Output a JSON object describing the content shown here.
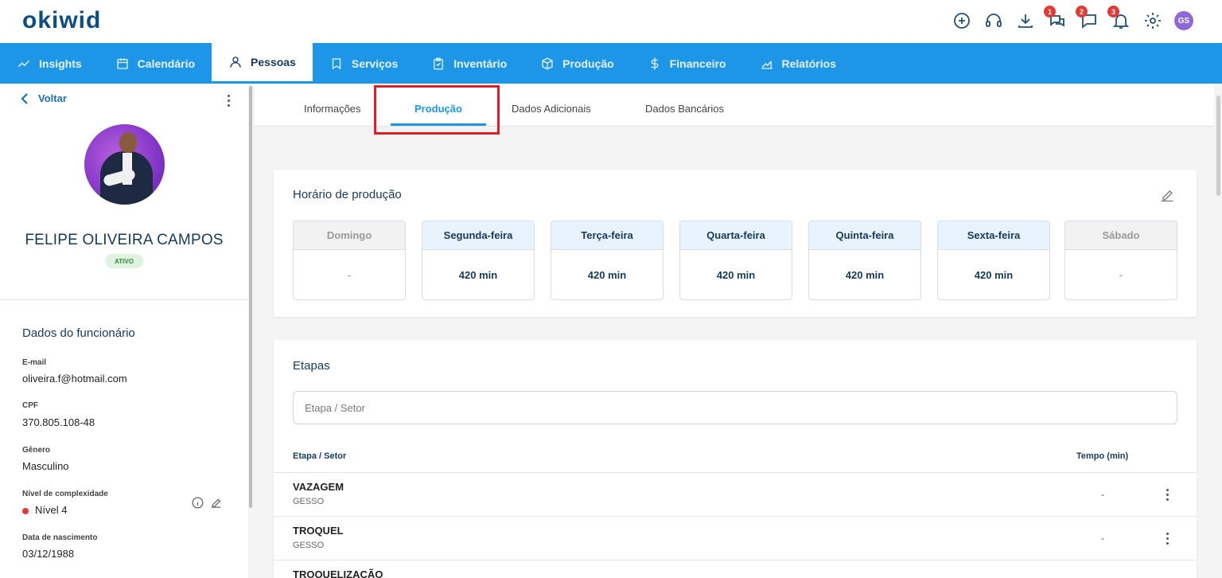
{
  "brand": {
    "logo_text": "okiwid"
  },
  "header": {
    "icons": [
      "plus-circle-icon",
      "headset-icon",
      "download-icon",
      "chat-bubbles-icon",
      "chat-icon",
      "bell-icon",
      "gear-icon"
    ],
    "badges": {
      "chat_bubbles": "1",
      "chat": "2",
      "bell": "3"
    },
    "avatar_initials": "GS"
  },
  "nav": {
    "items": [
      {
        "label": "Insights",
        "icon": "trend-icon"
      },
      {
        "label": "Calendário",
        "icon": "calendar-icon"
      },
      {
        "label": "Pessoas",
        "icon": "person-icon",
        "active": true
      },
      {
        "label": "Serviços",
        "icon": "bookmark-icon"
      },
      {
        "label": "Inventário",
        "icon": "clipboard-icon"
      },
      {
        "label": "Produção",
        "icon": "box-icon"
      },
      {
        "label": "Financeiro",
        "icon": "dollar-icon"
      },
      {
        "label": "Relatórios",
        "icon": "chart-icon"
      }
    ]
  },
  "sidebar": {
    "back_label": "Voltar",
    "employee_name": "FELIPE OLIVEIRA CAMPOS",
    "status": "ATIVO",
    "section_title": "Dados do funcionário",
    "fields": [
      {
        "label": "E-mail",
        "value": "oliveira.f@hotmail.com"
      },
      {
        "label": "CPF",
        "value": "370.805.108-48"
      },
      {
        "label": "Gênero",
        "value": "Masculino"
      },
      {
        "label": "Nível de complexidade",
        "value": "Nível 4"
      },
      {
        "label": "Data de nascimento",
        "value": "03/12/1988"
      }
    ]
  },
  "tabs": {
    "items": [
      "Informações",
      "Produção",
      "Dados Adicionais",
      "Dados Bancários"
    ],
    "active": "Produção"
  },
  "production_schedule": {
    "title": "Horário de produção",
    "days": [
      {
        "name": "Domingo",
        "value": "-",
        "enabled": false
      },
      {
        "name": "Segunda-feira",
        "value": "420 min",
        "enabled": true
      },
      {
        "name": "Terça-feira",
        "value": "420 min",
        "enabled": true
      },
      {
        "name": "Quarta-feira",
        "value": "420 min",
        "enabled": true
      },
      {
        "name": "Quinta-feira",
        "value": "420 min",
        "enabled": true
      },
      {
        "name": "Sexta-feira",
        "value": "420 min",
        "enabled": true
      },
      {
        "name": "Sábado",
        "value": "-",
        "enabled": false
      }
    ]
  },
  "stages": {
    "title": "Etapas",
    "search_placeholder": "Etapa / Setor",
    "columns": [
      "Etapa / Setor",
      "Tempo (min)"
    ],
    "rows": [
      {
        "name": "VAZAGEM",
        "sector": "GESSO",
        "time": "-"
      },
      {
        "name": "TROQUEL",
        "sector": "GESSO",
        "time": "-"
      },
      {
        "name": "TROQUELIZAÇÃO",
        "sector": "",
        "time": "-"
      }
    ]
  },
  "colors": {
    "primary": "#1e96e8",
    "navy": "#163a5c",
    "highlight": "#e21d25",
    "badge": "#e53935"
  }
}
